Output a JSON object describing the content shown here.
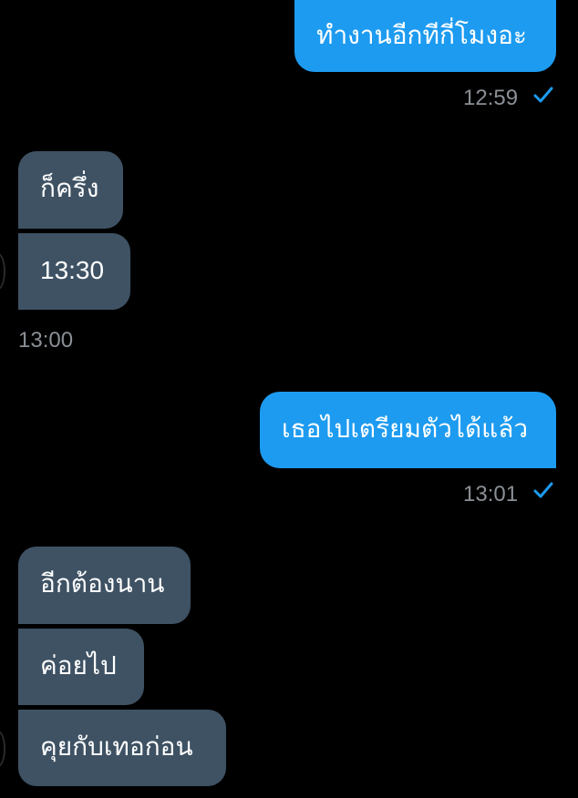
{
  "colors": {
    "outgoing_bubble": "#1d9bf0",
    "incoming_bubble": "#3e5264",
    "background": "#000000",
    "timestamp": "#8a8f96",
    "check": "#1d9bf0"
  },
  "messages": [
    {
      "direction": "outgoing",
      "text": "ทำงานอีกทีกี่โมงอะ"
    },
    {
      "direction": "outgoing",
      "time": "12:59",
      "status": "sent-check-icon"
    },
    {
      "direction": "incoming",
      "text": "ก็ครึ่ง"
    },
    {
      "direction": "incoming",
      "text": "13:30"
    },
    {
      "direction": "incoming",
      "time": "13:00"
    },
    {
      "direction": "outgoing",
      "text": "เธอไปเตรียมตัวได้แล้ว"
    },
    {
      "direction": "outgoing",
      "time": "13:01",
      "status": "sent-check-icon"
    },
    {
      "direction": "incoming",
      "text": "อีกต้องนาน"
    },
    {
      "direction": "incoming",
      "text": "ค่อยไป"
    },
    {
      "direction": "incoming",
      "text": "คุยกับเทอก่อน"
    }
  ]
}
